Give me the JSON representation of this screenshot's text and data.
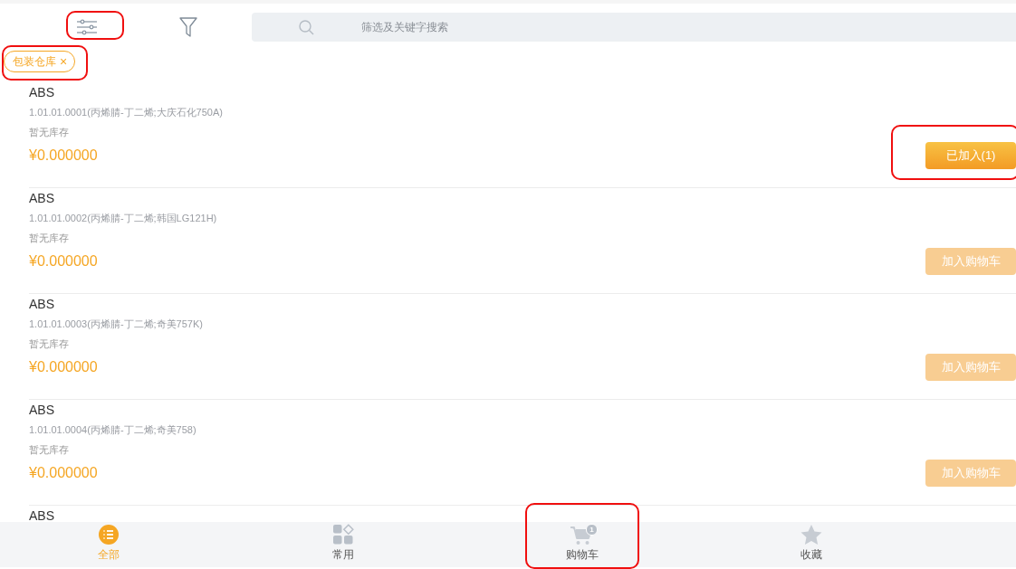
{
  "toolbar": {
    "settings_highlighted": true,
    "search": {
      "placeholder": "筛选及关键字搜索"
    }
  },
  "filter_tags": [
    {
      "label": "包装仓库",
      "close": "×",
      "highlighted": true
    }
  ],
  "products": [
    {
      "name": "ABS",
      "code": "1.01.01.0001(丙烯腈-丁二烯;大庆石化750A)",
      "stock": "暂无库存",
      "price": "¥0.000000",
      "button": "已加入(1)",
      "added": true,
      "highlighted": true
    },
    {
      "name": "ABS",
      "code": "1.01.01.0002(丙烯腈-丁二烯;韩国LG121H)",
      "stock": "暂无库存",
      "price": "¥0.000000",
      "button": "加入购物车",
      "added": false,
      "highlighted": false
    },
    {
      "name": "ABS",
      "code": "1.01.01.0003(丙烯腈-丁二烯;奇美757K)",
      "stock": "暂无库存",
      "price": "¥0.000000",
      "button": "加入购物车",
      "added": false,
      "highlighted": false
    },
    {
      "name": "ABS",
      "code": "1.01.01.0004(丙烯腈-丁二烯;奇美758)",
      "stock": "暂无库存",
      "price": "¥0.000000",
      "button": "加入购物车",
      "added": false,
      "highlighted": false
    },
    {
      "name": "ABS"
    }
  ],
  "bottom_nav": [
    {
      "kind": "all",
      "label": "全部",
      "selected": true,
      "highlighted": false
    },
    {
      "kind": "common",
      "label": "常用",
      "selected": false,
      "highlighted": false
    },
    {
      "kind": "cart",
      "label": "购物车",
      "badge": "1",
      "selected": false,
      "highlighted": true
    },
    {
      "kind": "favorites",
      "label": "收藏",
      "selected": false,
      "highlighted": false
    }
  ]
}
